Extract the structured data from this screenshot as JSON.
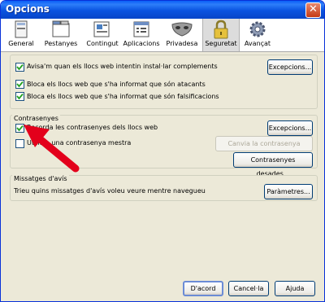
{
  "window": {
    "title": "Opcions"
  },
  "tabs": [
    {
      "label": "General"
    },
    {
      "label": "Pestanyes"
    },
    {
      "label": "Contingut"
    },
    {
      "label": "Aplicacions"
    },
    {
      "label": "Privadesa"
    },
    {
      "label": "Seguretat"
    },
    {
      "label": "Avançat"
    }
  ],
  "selected_tab": "Seguretat",
  "addons": {
    "warn_label": "Avisa'm quan els llocs web intentin instal·lar complements",
    "warn_checked": true,
    "exceptions_label": "Excepcions...",
    "attack_label": "Bloca els llocs web que s'ha informat que són atacants",
    "attack_checked": true,
    "forgery_label": "Bloca els llocs web que s'ha informat que són falsificacions",
    "forgery_checked": true
  },
  "passwords": {
    "legend": "Contrasenyes",
    "remember_label": "Recorda les contrasenyes dels llocs web",
    "remember_checked": true,
    "exceptions_label": "Excepcions...",
    "master_label": "Utilitza una contrasenya mestra",
    "master_checked": false,
    "change_master_label": "Canvia la contrasenya mestra...",
    "saved_label": "Contrasenyes desades..."
  },
  "warnings": {
    "legend": "Missatges d'avís",
    "text": "Trieu quins missatges d'avís voleu veure mentre navegueu",
    "settings_label": "Paràmetres..."
  },
  "footer": {
    "ok_label": "D'acord",
    "cancel_label": "Cancel·la",
    "help_label": "Ajuda"
  },
  "colors": {
    "title_bar": "#0a53e0",
    "dialog_bg": "#ece9d8",
    "annotation_arrow": "#e3001b",
    "check": "#21a121"
  }
}
